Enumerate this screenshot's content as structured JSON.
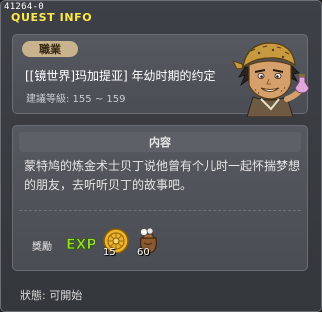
{
  "window": {
    "quest_id": "41264-0",
    "title": "QUEST INFO"
  },
  "header": {
    "job_badge": "職業",
    "quest_name": "[[镜世界]玛加提亚] 年幼时期的约定",
    "level_requirement": "建議等級: 155 ~ 159",
    "npc_icon": "npc-portrait-icon"
  },
  "content": {
    "header": "内容",
    "description": "蒙特鸠的炼金术士贝丁说他曾有个儿时一起怀揣梦想的朋友，去听听贝丁的故事吧。"
  },
  "rewards": {
    "label": "獎勵",
    "items": [
      {
        "icon": "exp-icon",
        "count": ""
      },
      {
        "icon": "coin-icon",
        "count": "15"
      },
      {
        "icon": "bag-icon",
        "count": "60"
      }
    ]
  },
  "status": {
    "text": "狀態:  可開始"
  },
  "colors": {
    "title": "#ffe84a",
    "badge_bg": "#c8b38d",
    "exp_text": "#9be02b"
  }
}
